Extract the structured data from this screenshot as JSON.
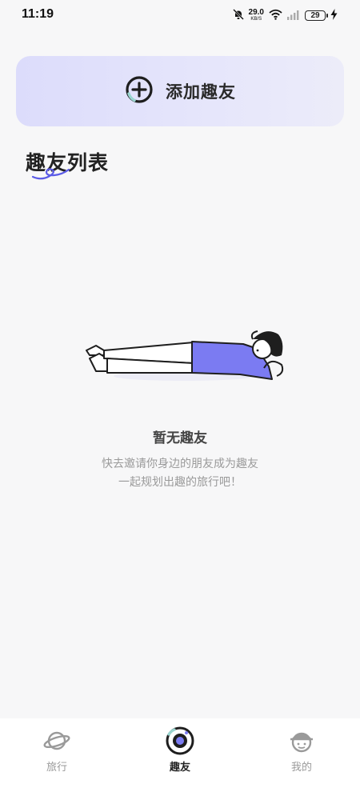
{
  "status_bar": {
    "time": "11:19",
    "speed_value": "29.0",
    "speed_unit": "KB/S",
    "battery": "29",
    "icons": [
      "mute-bell-icon",
      "wifi-icon",
      "signal-icon",
      "battery-icon",
      "charging-icon"
    ]
  },
  "add_friend": {
    "label": "添加趣友",
    "icon": "plus-circle-icon"
  },
  "list": {
    "title": "趣友列表"
  },
  "empty_state": {
    "title": "暂无趣友",
    "line1": "快去邀请你身边的朋友成为趣友",
    "line2": "一起规划出趣的旅行吧！"
  },
  "nav": {
    "items": [
      {
        "label": "旅行",
        "icon": "planet-icon",
        "active": false
      },
      {
        "label": "趣友",
        "icon": "lens-icon",
        "active": true
      },
      {
        "label": "我的",
        "icon": "face-cap-icon",
        "active": false
      }
    ]
  },
  "colors": {
    "accent": "#7b7bf2",
    "card_bg": "#e2e2fb",
    "text_primary": "#222222",
    "text_secondary": "#9a9a9a"
  }
}
